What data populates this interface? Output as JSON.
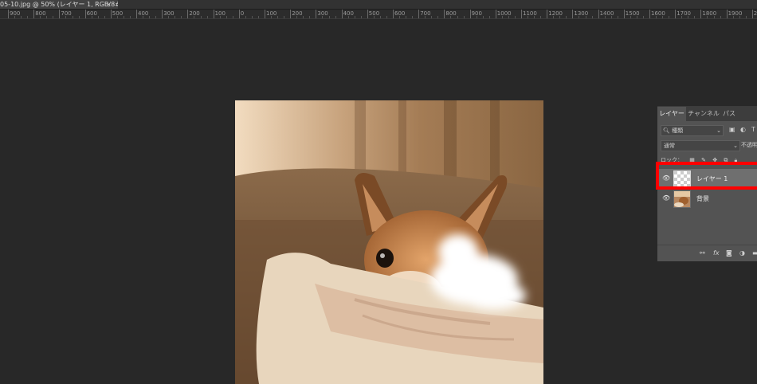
{
  "document": {
    "tab_title": "05-10.jpg @ 50% (レイヤー 1, RGB/8#) *",
    "close_glyph": "×"
  },
  "ruler": {
    "labels": [
      "900",
      "800",
      "700",
      "600",
      "500",
      "400",
      "300",
      "200",
      "100",
      "0",
      "100",
      "200",
      "300",
      "400",
      "500",
      "600",
      "700",
      "800",
      "900",
      "1000",
      "1100",
      "1200",
      "1300",
      "1400",
      "1500",
      "1600",
      "1700",
      "1800",
      "1900",
      "2000"
    ]
  },
  "layers_panel": {
    "tabs": [
      "レイヤー",
      "チャンネル",
      "パス"
    ],
    "active_tab": "レイヤー",
    "filter_label": "種類",
    "blend_mode": "通常",
    "opacity_label": "不透明",
    "lock_label": "ロック：",
    "layers": [
      {
        "name": "レイヤー 1",
        "selected": true,
        "thumb": "transparent"
      },
      {
        "name": "背景",
        "selected": false,
        "thumb": "photo"
      }
    ],
    "footer_icons": [
      "link-icon",
      "fx-icon",
      "mask-icon",
      "adjustment-icon",
      "folder-icon"
    ],
    "footer_fx_label": "fx"
  },
  "annotation": {
    "highlight_color": "#ff0000",
    "highlight_target": "レイヤー 1"
  }
}
